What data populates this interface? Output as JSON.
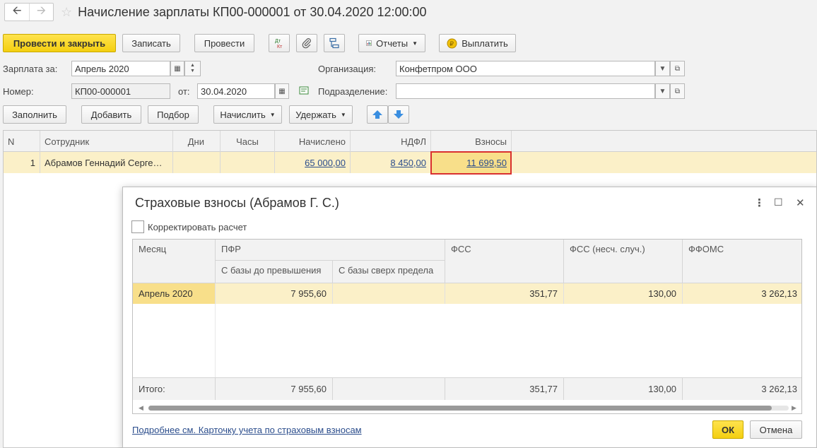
{
  "window": {
    "title": "Начисление зарплаты КП00-000001 от 30.04.2020 12:00:00"
  },
  "toolbar": {
    "post_close": "Провести и закрыть",
    "save": "Записать",
    "post": "Провести",
    "dt_kt_top": "Дт",
    "dt_kt_bottom": "Кт",
    "reports": "Отчеты",
    "pay": "Выплатить"
  },
  "form": {
    "salary_for_label": "Зарплата за:",
    "salary_for_value": "Апрель 2020",
    "org_label": "Организация:",
    "org_value": "Конфетпром ООО",
    "number_label": "Номер:",
    "number_value": "КП00-000001",
    "from_label": "от:",
    "from_value": "30.04.2020",
    "division_label": "Подразделение:",
    "division_value": ""
  },
  "table_toolbar": {
    "fill": "Заполнить",
    "add": "Добавить",
    "pick": "Подбор",
    "accrue": "Начислить",
    "withhold": "Удержать"
  },
  "main_table": {
    "columns": [
      "N",
      "Сотрудник",
      "Дни",
      "Часы",
      "Начислено",
      "НДФЛ",
      "Взносы"
    ],
    "rows": [
      {
        "n": "1",
        "employee": "Абрамов Геннадий Серге…",
        "days": "",
        "hours": "",
        "accrued": "65 000,00",
        "ndfl": "8 450,00",
        "contributions": "11 699,50"
      }
    ]
  },
  "dialog": {
    "title": "Страховые взносы (Абрамов Г. С.)",
    "adjust_label": "Корректировать расчет",
    "headers": {
      "month": "Месяц",
      "pfr": "ПФР",
      "pfr_base": "С базы до превышения",
      "pfr_over": "С базы сверх предела",
      "fss": "ФСС",
      "fss_ns": "ФСС (несч. случ.)",
      "ffoms": "ФФОМС"
    },
    "rows": [
      {
        "month": "Апрель 2020",
        "pfr_base": "7 955,60",
        "pfr_over": "",
        "fss": "351,77",
        "fss_ns": "130,00",
        "ffoms": "3 262,13"
      }
    ],
    "totals": {
      "label": "Итого:",
      "pfr_base": "7 955,60",
      "pfr_over": "",
      "fss": "351,77",
      "fss_ns": "130,00",
      "ffoms": "3 262,13"
    },
    "link": "Подробнее см. Карточку учета по страховым взносам",
    "ok": "ОК",
    "cancel": "Отмена"
  }
}
